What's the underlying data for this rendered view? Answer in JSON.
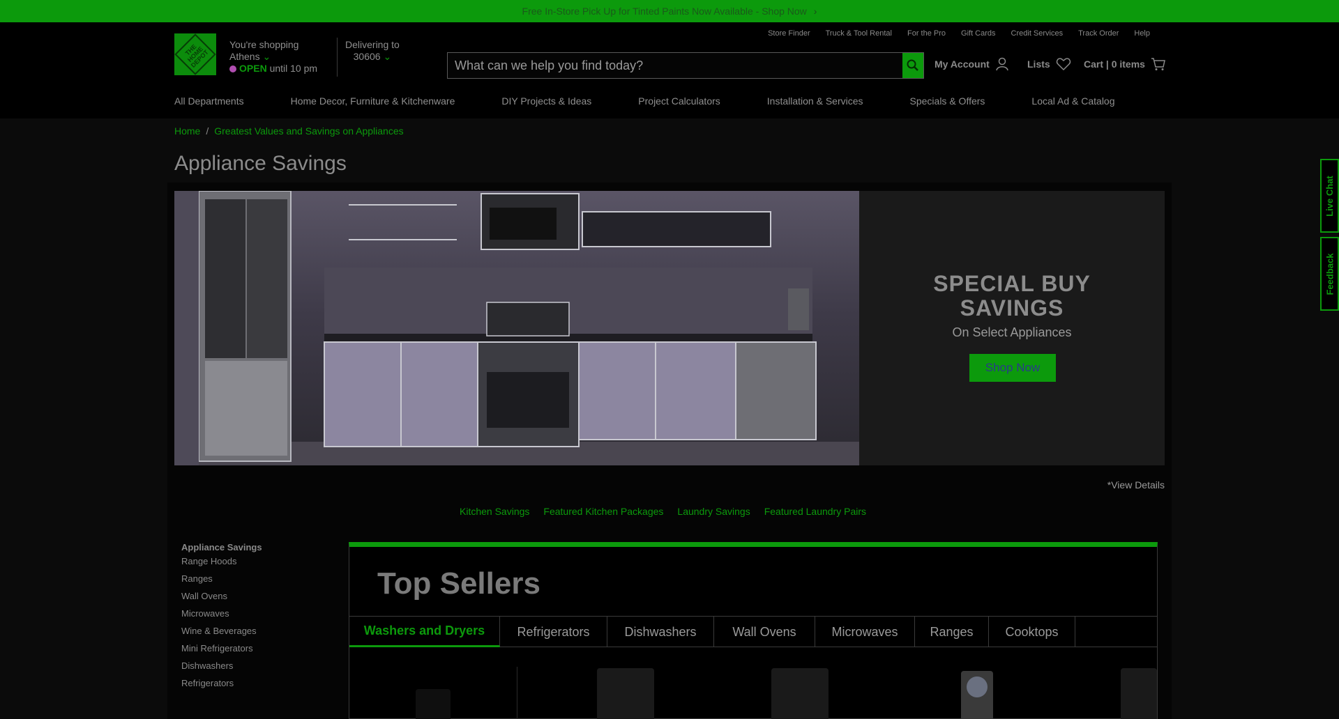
{
  "promo": {
    "text": "Free In-Store Pick Up for Tinted Paints Now Available - Shop Now"
  },
  "header": {
    "logo": [
      "THE",
      "HOME",
      "DEPOT"
    ],
    "store_prefix": "You're shopping",
    "store_city": "Athens",
    "store_status": "OPEN",
    "store_hours": "until 10 pm",
    "delivery_prefix": "Delivering to",
    "delivery_zip": "30606",
    "utility_links": [
      "Store Finder",
      "Truck & Tool Rental",
      "For the Pro",
      "Gift Cards",
      "Credit Services",
      "Track Order",
      "Help"
    ],
    "search_placeholder": "What can we help you find today?",
    "my_account": "My Account",
    "lists": "Lists",
    "cart": "Cart | 0 items"
  },
  "main_nav": [
    "All Departments",
    "Home Decor, Furniture & Kitchenware",
    "DIY Projects & Ideas",
    "Project Calculators",
    "Installation & Services",
    "Specials & Offers",
    "Local Ad & Catalog"
  ],
  "breadcrumb": {
    "home": "Home",
    "current": "Greatest Values and Savings on Appliances"
  },
  "page_title": "Appliance Savings",
  "hero": {
    "headline_line1": "SPECIAL BUY",
    "headline_line2": "SAVINGS",
    "subtitle": "On Select Appliances",
    "cta": "Shop Now"
  },
  "view_details": "*View Details",
  "sub_nav": [
    "Kitchen Savings",
    "Featured Kitchen Packages",
    "Laundry Savings",
    "Featured Laundry Pairs"
  ],
  "sidebar": {
    "heading": "Appliance Savings",
    "items": [
      "Range Hoods",
      "Ranges",
      "Wall Ovens",
      "Microwaves",
      "Wine & Beverages",
      "Mini Refrigerators",
      "Dishwashers",
      "Refrigerators"
    ]
  },
  "top_sellers": {
    "title": "Top Sellers",
    "tabs": [
      "Washers and Dryers",
      "Refrigerators",
      "Dishwashers",
      "Wall Ovens",
      "Microwaves",
      "Ranges",
      "Cooktops"
    ],
    "active_tab": "Washers and Dryers"
  },
  "side_tabs": {
    "live_chat": "Live Chat",
    "feedback": "Feedback"
  },
  "colors": {
    "accent": "#0c9a0c",
    "background": "#0b0b0b"
  }
}
